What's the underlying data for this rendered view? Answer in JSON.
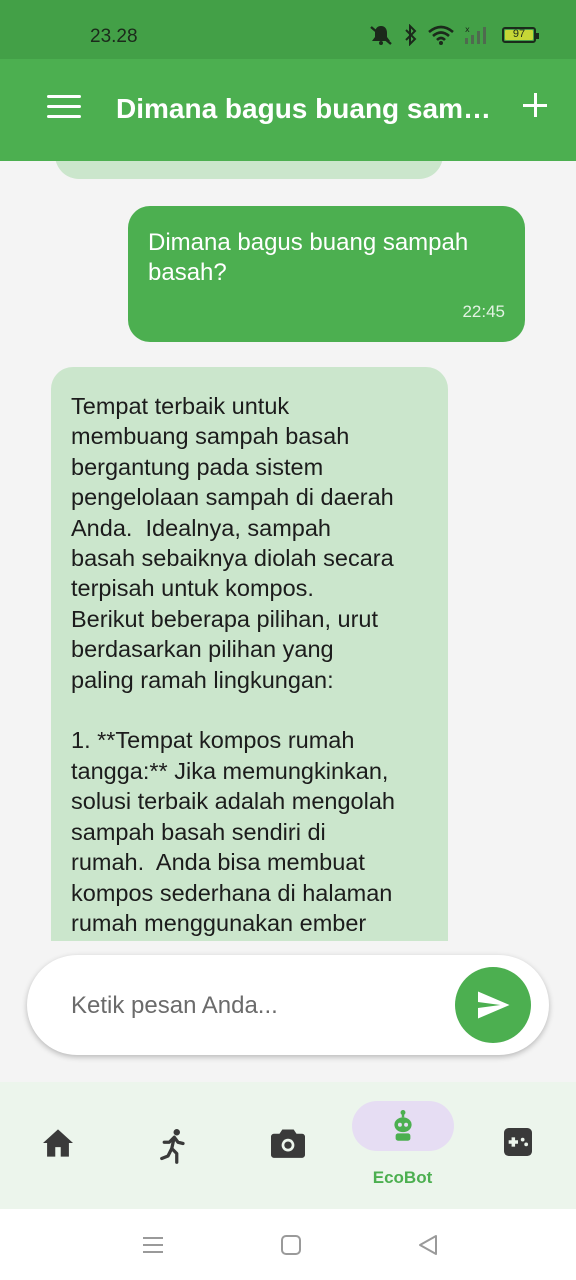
{
  "status_bar": {
    "time": "23.28",
    "battery_level": "97",
    "icons": [
      "mute-icon",
      "bluetooth-icon",
      "wifi-icon",
      "signal-icon",
      "battery-icon"
    ]
  },
  "app_bar": {
    "title": "Dimana bagus buang sampah basah?",
    "menu_icon": "hamburger-menu-icon",
    "add_icon": "plus-icon"
  },
  "chat": {
    "messages": [
      {
        "sender": "user",
        "text": "Dimana bagus buang sampah basah?",
        "time": "22:45"
      },
      {
        "sender": "bot",
        "text": "Tempat terbaik untuk\nmembuang sampah basah\nbergantung pada sistem\npengelolaan sampah di daerah\nAnda.  Idealnya, sampah\nbasah sebaiknya diolah secara\nterpisah untuk kompos.\nBerikut beberapa pilihan, urut\nberdasarkan pilihan yang\npaling ramah lingkungan:\n\n1. **Tempat kompos rumah\ntangga:** Jika memungkinkan,\nsolusi terbaik adalah mengolah\nsampah basah sendiri di\nrumah.  Anda bisa membuat\nkompos sederhana di halaman\nrumah menggunakan ember"
      }
    ]
  },
  "composer": {
    "placeholder": "Ketik pesan Anda...",
    "value": "",
    "send_icon": "send-icon"
  },
  "bottom_nav": {
    "items": [
      {
        "icon": "home-icon",
        "label": ""
      },
      {
        "icon": "activity-walk-icon",
        "label": ""
      },
      {
        "icon": "camera-icon",
        "label": ""
      },
      {
        "icon": "robot-icon",
        "label": "EcoBot",
        "active": true
      },
      {
        "icon": "game-controller-icon",
        "label": ""
      }
    ]
  },
  "system_nav": {
    "icons": [
      "recent-apps-icon",
      "home-square-icon",
      "back-triangle-icon"
    ]
  },
  "colors": {
    "status_bar": "#43a047",
    "primary": "#4caf50",
    "bot_bubble": "#cbe6cc",
    "background": "#f4f4f4",
    "active_pill": "#e6ddf3"
  }
}
